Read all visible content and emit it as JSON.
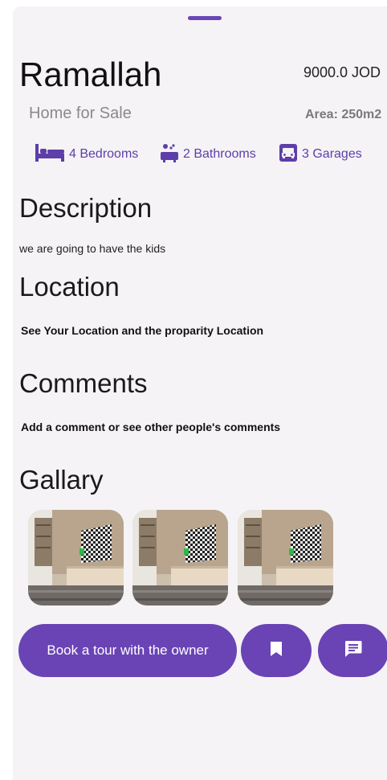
{
  "property": {
    "city": "Ramallah",
    "price": "9000.0 JOD",
    "type": "Home for Sale",
    "area": "Area: 250m2"
  },
  "features": [
    {
      "icon": "bed-icon",
      "label": "4 Bedrooms"
    },
    {
      "icon": "bathtub-icon",
      "label": "2 Bathrooms"
    },
    {
      "icon": "car-icon",
      "label": "3 Garages"
    }
  ],
  "sections": {
    "description": {
      "heading": "Description",
      "text": "we are going to have the kids"
    },
    "location": {
      "heading": "Location",
      "text": "See Your Location and the proparity Location"
    },
    "comments": {
      "heading": "Comments",
      "text": "Add a comment or see other people's comments"
    },
    "gallery": {
      "heading": "Gallary"
    }
  },
  "actions": {
    "book_tour_label": "Book a tour with the owner",
    "bookmark_icon": "bookmark-icon",
    "message_icon": "message-icon"
  },
  "colors": {
    "accent": "#6a43b5",
    "background": "#f5f3f6"
  }
}
